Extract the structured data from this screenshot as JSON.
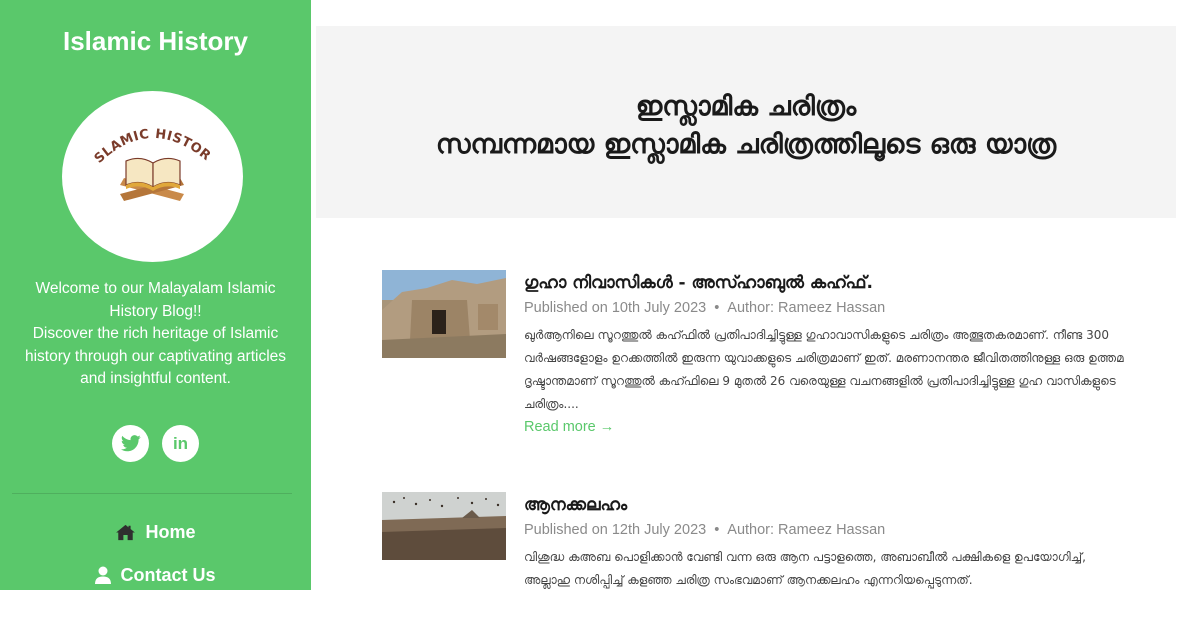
{
  "sidebar": {
    "site_title": "Islamic History",
    "logo": {
      "text": "ISLAMIC HISTORY",
      "icon": "open-book-on-stand-icon"
    },
    "welcome_line1": "Welcome to our Malayalam Islamic History Blog!!",
    "welcome_line2": "Discover the rich heritage of Islamic history through our captivating articles and insightful content.",
    "social": [
      {
        "name": "twitter",
        "icon": "twitter-icon"
      },
      {
        "name": "linkedin",
        "icon": "linkedin-icon",
        "label": "in"
      }
    ],
    "nav": [
      {
        "label": "Home",
        "icon": "home-icon"
      },
      {
        "label": "Contact Us",
        "icon": "user-icon"
      }
    ]
  },
  "hero": {
    "title_line1": "ഇസ്ലാമിക ചരിത്രം",
    "title_line2": "സമ്പന്നമായ ഇസ്ലാമിക ചരിത്രത്തിലൂടെ ഒരു യാത്ര"
  },
  "posts": [
    {
      "title": "ഗുഹാ നിവാസികൾ - അസ്ഹാബുൽ കഹ്ഫ്.",
      "published": "Published on 10th July 2023",
      "separator": "•",
      "author": "Author: Rameez Hassan",
      "excerpt": "ഖുർആനിലെ സൂറത്തുൽ കഹ്ഫിൽ പ്രതിപാദിച്ചിട്ടുള്ള ഗുഹാവാസികളുടെ ചരിത്രം അത്ഭുതകരമാണ്. നീണ്ട 300 വർഷങ്ങളോളം ഉറക്കത്തിൽ ഇരുന്ന യുവാക്കളുടെ ചരിത്രമാണ് ഇത്. മരണാനന്തര ജീവിതത്തിനുള്ള ഒരു ഉത്തമ ദൃഷ്ടാന്തമാണ് സൂറത്തുൽ കഹ്ഫിലെ 9 മുതൽ 26 വരെയുള്ള വചനങ്ങളിൽ പ്രതിപാദിച്ചിട്ടുള്ള ഗുഹ വാസികളുടെ ചരിത്രം....",
      "read_more": "Read more →"
    },
    {
      "title": "ആനക്കലഹം",
      "published": "Published on 12th July 2023",
      "separator": "•",
      "author": "Author: Rameez Hassan",
      "excerpt": "വിശുദ്ധ കഅബ പൊളിക്കാൻ വേണ്ടി വന്ന ഒരു ആന പട്ടാളത്തെ, അബാബീൽ പക്ഷികളെ ഉപയോഗിച്ച്, അല്ലാഹു നശിപ്പിച്ച് കളഞ്ഞ ചരിത്ര സംഭവമാണ് ആനക്കലഹം എന്നറിയപ്പെടുന്നത്."
    }
  ],
  "colors": {
    "sidebar_bg": "#5ac86b",
    "accent": "#5ac86b",
    "hero_bg": "#f4f4f4"
  }
}
